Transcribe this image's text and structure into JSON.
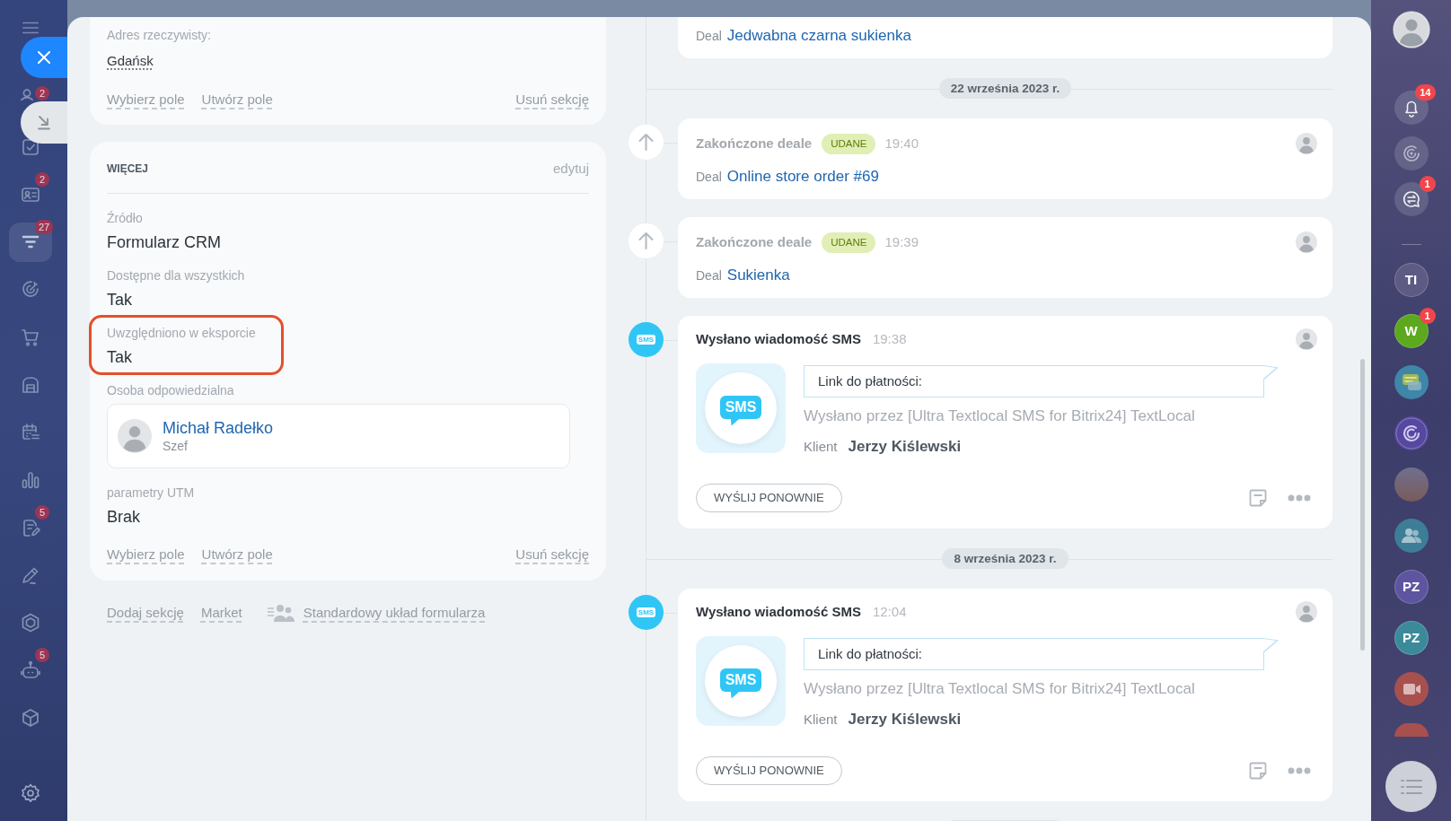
{
  "left_sidebar": {
    "items": [
      {
        "kind": "user",
        "badge": "2",
        "selected": false
      },
      {
        "kind": "tasks",
        "selected": false
      },
      {
        "kind": "contacts",
        "badge": "2",
        "selected": false
      },
      {
        "kind": "funnel",
        "badge": "27",
        "selected": true
      },
      {
        "kind": "target",
        "selected": false
      },
      {
        "kind": "cart",
        "selected": false
      },
      {
        "kind": "warehouse",
        "selected": false
      },
      {
        "kind": "calendar",
        "selected": false
      },
      {
        "kind": "chart",
        "selected": false
      },
      {
        "kind": "document",
        "badge": "5",
        "selected": false
      },
      {
        "kind": "pen",
        "selected": false
      },
      {
        "kind": "hexagon",
        "selected": false
      },
      {
        "kind": "robot",
        "badge": "5",
        "selected": false
      },
      {
        "kind": "cube",
        "selected": false
      }
    ]
  },
  "details": {
    "sections": [
      {
        "kind": "cut",
        "fields": [
          {
            "kind": "link",
            "label": "Adres rzeczywisty:",
            "value": "Gdańsk",
            "highlighted": false
          }
        ],
        "actions": [
          "Wybierz pole",
          "Utwórz pole"
        ],
        "remove": "Usuń sekcję"
      },
      {
        "kind": "titled",
        "title": "WIĘCEJ",
        "edit": "edytuj",
        "fields": [
          {
            "kind": "text",
            "label": "Źródło",
            "value": "Formularz CRM",
            "highlighted": false
          },
          {
            "kind": "text",
            "label": "Dostępne dla wszystkich",
            "value": "Tak",
            "highlighted": false
          },
          {
            "kind": "text",
            "label": "Uwzględniono w eksporcie",
            "value": "Tak",
            "highlighted": true
          },
          {
            "kind": "person",
            "label": "Osoba odpowiedzialna",
            "name": "Michał Radełko",
            "role": "Szef",
            "highlighted": false
          },
          {
            "kind": "text",
            "label": "parametry UTM",
            "value": "Brak",
            "highlighted": false
          }
        ],
        "actions": [
          "Wybierz pole",
          "Utwórz pole"
        ],
        "remove": "Usuń sekcję"
      }
    ],
    "footer_links": [
      {
        "kind": "plain",
        "label": "Dodaj sekcję"
      },
      {
        "kind": "plain",
        "label": "Market"
      },
      {
        "kind": "layout",
        "label": "Standardowy układ formularza"
      }
    ]
  },
  "timeline": {
    "items": [
      {
        "kind": "deal_cut",
        "deal_label": "Deal",
        "deal_name": "Jedwabna czarna sukienka"
      },
      {
        "kind": "date",
        "text": "22 września 2023 r."
      },
      {
        "kind": "deal_closed",
        "title": "Zakończone deale",
        "badge": "UDANE",
        "time": "19:40",
        "deal_label": "Deal",
        "deal_name": "Online store order #69"
      },
      {
        "kind": "deal_closed",
        "title": "Zakończone deale",
        "badge": "UDANE",
        "time": "19:39",
        "deal_label": "Deal",
        "deal_name": "Sukienka"
      },
      {
        "kind": "sms",
        "marker_label": "SMS",
        "title": "Wysłano wiadomość SMS",
        "time": "19:38",
        "logo_label": "SMS",
        "message": "Link do płatności:",
        "sender": "Wysłano przez [Ultra Textlocal SMS for Bitrix24] TextLocal",
        "client_label": "Klient",
        "client_name": "Jerzy Kiślewski",
        "button": "WYŚLIJ PONOWNIE"
      },
      {
        "kind": "date",
        "text": "8 września 2023 r."
      },
      {
        "kind": "sms",
        "marker_label": "SMS",
        "title": "Wysłano wiadomość SMS",
        "time": "12:04",
        "logo_label": "SMS",
        "message": "Link do płatności:",
        "sender": "Wysłano przez [Ultra Textlocal SMS for Bitrix24] TextLocal",
        "client_label": "Klient",
        "client_name": "Jerzy Kiślewski",
        "button": "WYŚLIJ PONOWNIE"
      },
      {
        "kind": "date_cut"
      }
    ]
  },
  "right_sidebar": {
    "items": [
      {
        "kind": "avatar"
      },
      {
        "kind": "bell",
        "badge": "14"
      },
      {
        "kind": "swirl"
      },
      {
        "kind": "chat_sync",
        "badge": "1"
      },
      {
        "kind": "divider"
      },
      {
        "kind": "initials",
        "text": "TI",
        "color": "#5d5a83"
      },
      {
        "kind": "initials",
        "text": "W",
        "color": "#5ca81e",
        "badge": "1"
      },
      {
        "kind": "chat_app",
        "color": "#3f86a8"
      },
      {
        "kind": "swirl_app",
        "color": "#5647a0"
      },
      {
        "kind": "photo"
      },
      {
        "kind": "people",
        "color": "#3d7d97"
      },
      {
        "kind": "initials",
        "text": "PZ",
        "color": "#5e55a0"
      },
      {
        "kind": "initials",
        "text": "PZ",
        "color": "#3b8a9a"
      },
      {
        "kind": "video",
        "color": "#a8504e"
      },
      {
        "kind": "cut",
        "color": "#a8504e"
      }
    ]
  }
}
